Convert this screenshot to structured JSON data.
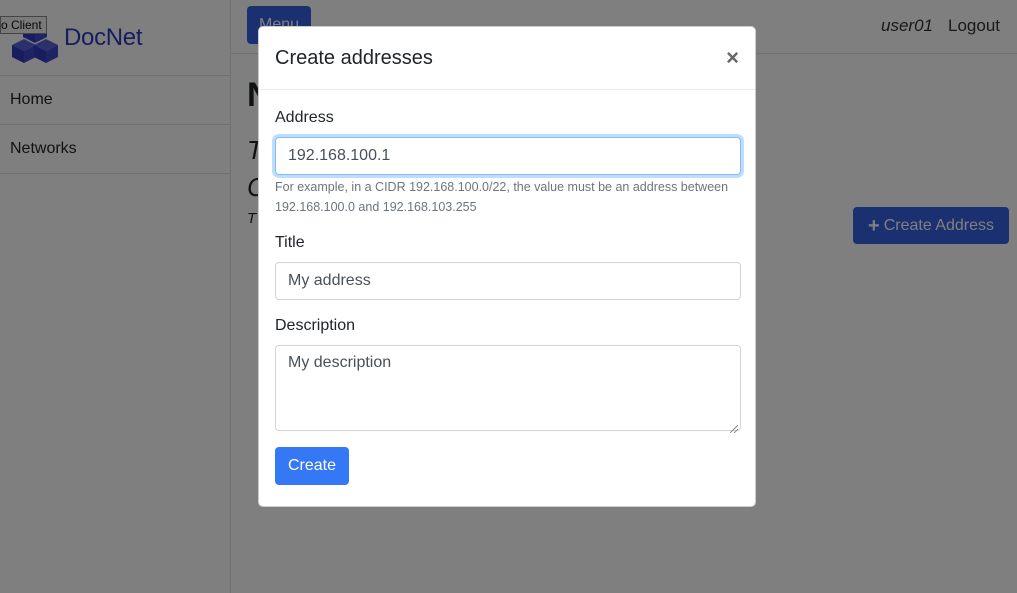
{
  "app": {
    "brand": "DocNet",
    "tooltip": "o Client"
  },
  "sidebar": {
    "items": [
      {
        "label": "Home"
      },
      {
        "label": "Networks"
      }
    ]
  },
  "topbar": {
    "menu_label": "Menu",
    "user": "user01",
    "logout_label": "Logout"
  },
  "main": {
    "title_char": "N",
    "line1_char": "T",
    "line2_char": "C",
    "line3_char": "T",
    "create_address_label": "Create Address"
  },
  "modal": {
    "title": "Create addresses",
    "close_symbol": "×",
    "address_label": "Address",
    "address_value": "192.168.100.1",
    "address_help": "For example, in a CIDR 192.168.100.0/22, the value must be an address between 192.168.100.0 and 192.168.103.255",
    "title_label": "Title",
    "title_value": "My address",
    "description_label": "Description",
    "description_value": "My description",
    "submit_label": "Create"
  },
  "colors": {
    "brand": "#2f3bbf",
    "primary": "#3478f6",
    "primary_dim": "#3461e0"
  },
  "icons": {
    "logo": "cubes-logo-icon",
    "close": "close-icon",
    "plus": "plus-icon"
  }
}
